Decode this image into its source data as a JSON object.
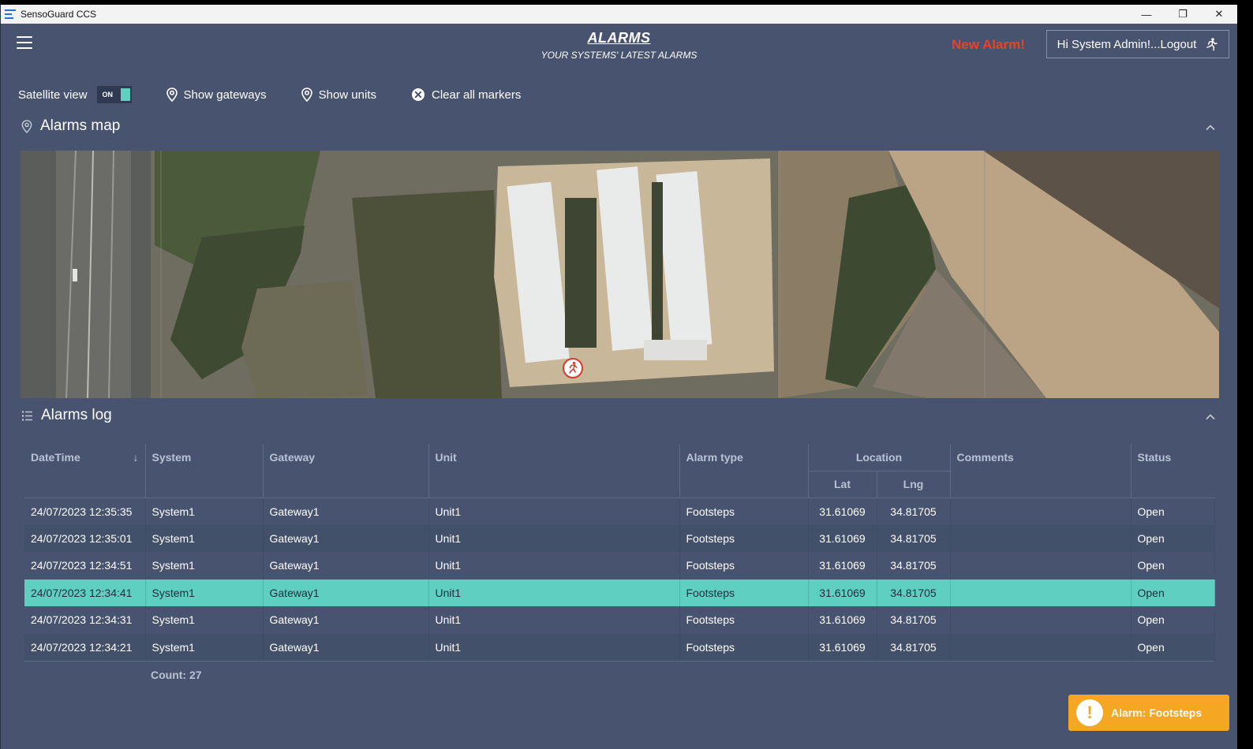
{
  "window": {
    "title": "SensoGuard CCS",
    "minimize": "—",
    "restore": "❐",
    "close": "✕"
  },
  "header": {
    "title": "ALARMS",
    "subtitle": "YOUR SYSTEMS' LATEST ALARMS",
    "new_alarm": "New Alarm!",
    "user_label": "Hi System Admin!...Logout"
  },
  "toolbar": {
    "satellite_label": "Satellite view",
    "satellite_toggle": "ON",
    "show_gateways": "Show gateways",
    "show_units": "Show units",
    "clear_markers": "Clear all markers"
  },
  "map_section": {
    "title": "Alarms map"
  },
  "log_section": {
    "title": "Alarms log"
  },
  "table": {
    "headers": {
      "datetime": "DateTime",
      "system": "System",
      "gateway": "Gateway",
      "unit": "Unit",
      "alarm_type": "Alarm type",
      "location": "Location",
      "lat": "Lat",
      "lng": "Lng",
      "comments": "Comments",
      "status": "Status"
    },
    "rows": [
      {
        "datetime": "24/07/2023 12:35:35",
        "system": "System1",
        "gateway": "Gateway1",
        "unit": "Unit1",
        "alarm_type": "Footsteps",
        "lat": "31.61069",
        "lng": "34.81705",
        "comments": "",
        "status": "Open"
      },
      {
        "datetime": "24/07/2023 12:35:01",
        "system": "System1",
        "gateway": "Gateway1",
        "unit": "Unit1",
        "alarm_type": "Footsteps",
        "lat": "31.61069",
        "lng": "34.81705",
        "comments": "",
        "status": "Open"
      },
      {
        "datetime": "24/07/2023 12:34:51",
        "system": "System1",
        "gateway": "Gateway1",
        "unit": "Unit1",
        "alarm_type": "Footsteps",
        "lat": "31.61069",
        "lng": "34.81705",
        "comments": "",
        "status": "Open"
      },
      {
        "datetime": "24/07/2023 12:34:41",
        "system": "System1",
        "gateway": "Gateway1",
        "unit": "Unit1",
        "alarm_type": "Footsteps",
        "lat": "31.61069",
        "lng": "34.81705",
        "comments": "",
        "status": "Open"
      },
      {
        "datetime": "24/07/2023 12:34:31",
        "system": "System1",
        "gateway": "Gateway1",
        "unit": "Unit1",
        "alarm_type": "Footsteps",
        "lat": "31.61069",
        "lng": "34.81705",
        "comments": "",
        "status": "Open"
      },
      {
        "datetime": "24/07/2023 12:34:21",
        "system": "System1",
        "gateway": "Gateway1",
        "unit": "Unit1",
        "alarm_type": "Footsteps",
        "lat": "31.61069",
        "lng": "34.81705",
        "comments": "",
        "status": "Open"
      }
    ],
    "selected_row": 3,
    "count": "Count: 27"
  },
  "toast": {
    "icon": "!",
    "text": "Alarm: Footsteps"
  },
  "colors": {
    "accent": "#5ecfc0",
    "background": "#48546f",
    "alert": "#e8432a",
    "toast": "#f5a623"
  }
}
